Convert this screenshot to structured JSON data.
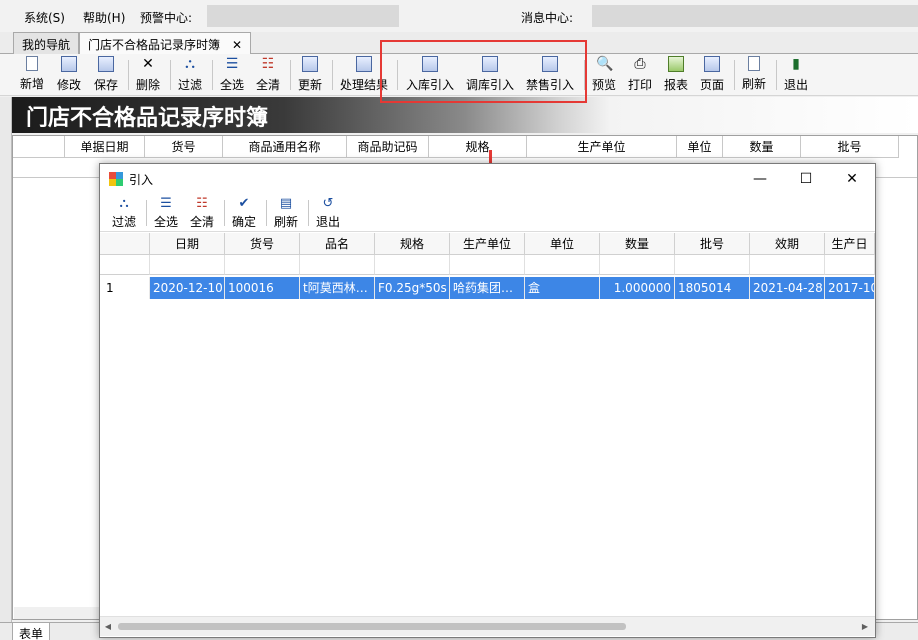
{
  "menubar": {
    "items": [
      "系统(S)",
      "帮助(H)",
      "预警中心:"
    ],
    "message_center": "消息中心:"
  },
  "tabs": [
    {
      "label": "我的导航"
    },
    {
      "label": "门店不合格品记录序时簿",
      "close": "✕"
    }
  ],
  "toolbar": {
    "buttons": [
      "新增",
      "修改",
      "保存",
      "删除",
      "过滤",
      "全选",
      "全清",
      "更新",
      "处理结果",
      "入库引入",
      "调库引入",
      "禁售引入",
      "预览",
      "打印",
      "报表",
      "页面",
      "刷新",
      "退出"
    ]
  },
  "banner": {
    "title": "门店不合格品记录序时簿"
  },
  "main_grid": {
    "columns": [
      "单据日期",
      "货号",
      "商品通用名称",
      "商品助记码",
      "规格",
      "生产单位",
      "单位",
      "数量",
      "批号"
    ]
  },
  "bottom_tab": "表单",
  "dialog": {
    "title": "引入",
    "window_buttons": {
      "minimize": "—",
      "maximize": "☐",
      "close": "✕"
    },
    "toolbar": [
      "过滤",
      "全选",
      "全清",
      "确定",
      "刷新",
      "退出"
    ],
    "columns": [
      "日期",
      "货号",
      "品名",
      "规格",
      "生产单位",
      "单位",
      "数量",
      "批号",
      "效期",
      "生产日"
    ],
    "rows": [
      {
        "row_number": "1",
        "cells": [
          "2020-12-10",
          "100016",
          "t阿莫西林…",
          "F0.25g*50s",
          "哈药集团…",
          "盒",
          "1.000000",
          "1805014",
          "2021-04-28",
          "2017-10"
        ]
      }
    ]
  },
  "colors": {
    "highlight": "#e53935",
    "selection": "#3d86e6"
  }
}
